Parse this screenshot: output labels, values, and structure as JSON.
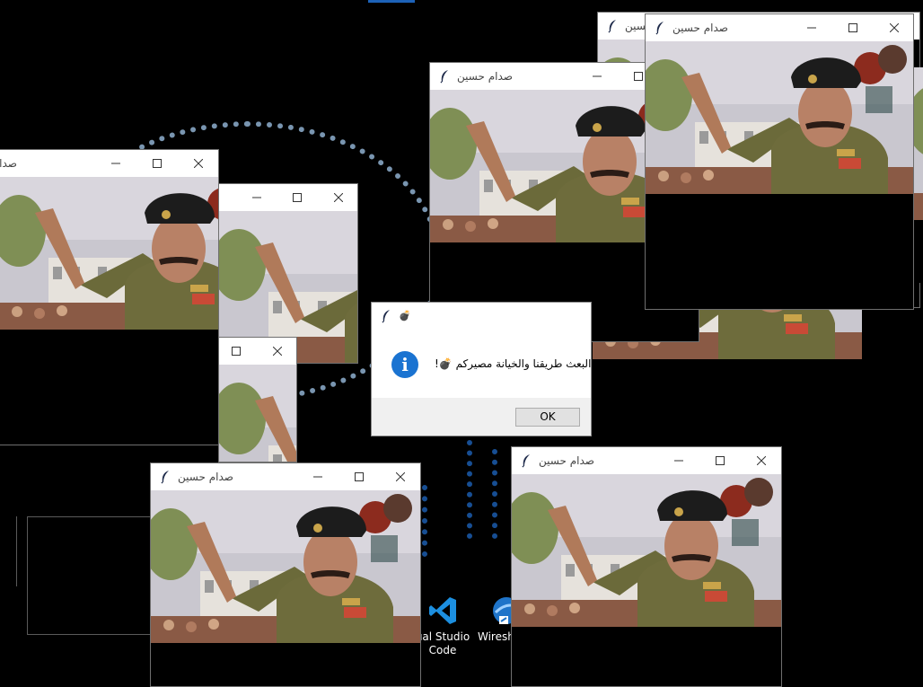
{
  "desktop": {
    "icons": [
      {
        "label": "ual Studio\nCode",
        "icon": "vscode-icon"
      },
      {
        "label": "Wiresh",
        "icon": "wireshark-icon"
      }
    ]
  },
  "window_title": "صدام حسين",
  "dialog": {
    "title": "",
    "message": "البعث طريقنا والخيانة مصيركم 💣!",
    "ok_label": "OK",
    "icon": "info-icon"
  },
  "colors": {
    "titlebar": "#ffffff",
    "info_icon": "#1a73d1",
    "wallpaper_accent": "#1d62b8"
  }
}
